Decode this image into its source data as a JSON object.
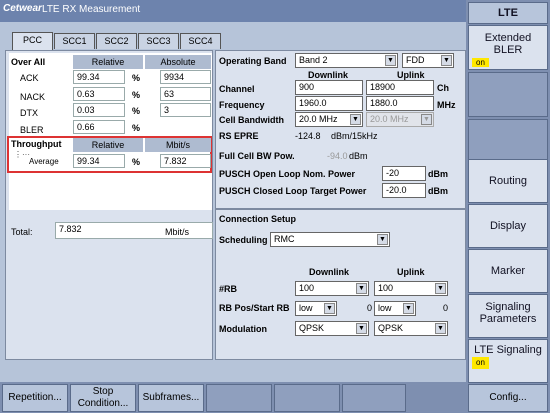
{
  "app": {
    "logo": "Cetwear",
    "title": "LTE RX Measurement"
  },
  "tabs": [
    "PCC",
    "SCC1",
    "SCC2",
    "SCC3",
    "SCC4"
  ],
  "overall": {
    "label": "Over All",
    "col_relative": "Relative",
    "col_absolute": "Absolute",
    "rows": [
      {
        "name": "ACK",
        "rel": "99.34",
        "unit": "%",
        "abs": "9934"
      },
      {
        "name": "NACK",
        "rel": "0.63",
        "unit": "%",
        "abs": "63"
      },
      {
        "name": "DTX",
        "rel": "0.03",
        "unit": "%",
        "abs": "3"
      },
      {
        "name": "BLER",
        "rel": "0.66",
        "unit": "%",
        "abs": ""
      }
    ]
  },
  "throughput": {
    "label": "Throughput",
    "col_relative": "Relative",
    "col_mbit": "Mbit/s",
    "avg_label": "Average",
    "rel": "99.34",
    "unit": "%",
    "mbit": "7.832"
  },
  "total": {
    "label": "Total:",
    "value": "7.832",
    "unit": "Mbit/s"
  },
  "band": {
    "op_band_label": "Operating Band",
    "op_band": "Band 2",
    "duplex": "FDD",
    "downlink": "Downlink",
    "uplink": "Uplink",
    "channel_label": "Channel",
    "ch_dl": "900",
    "ch_ul": "18900",
    "ch_unit": "Ch",
    "freq_label": "Frequency",
    "f_dl": "1960.0",
    "f_ul": "1880.0",
    "f_unit": "MHz",
    "bw_label": "Cell Bandwidth",
    "bw_dl": "20.0 MHz",
    "bw_ul": "20.0 MHz",
    "rsepre_label": "RS EPRE",
    "rsepre": "-124.8",
    "rsepre_unit": "dBm/15kHz",
    "fullcell_label": "Full Cell BW Pow.",
    "fullcell": "-94.0",
    "fullcell_unit": "dBm",
    "pusch_open_label": "PUSCH Open Loop Nom. Power",
    "pusch_open": "-20",
    "pusch_open_unit": "dBm",
    "pusch_closed_label": "PUSCH Closed Loop Target Power",
    "pusch_closed": "-20.0",
    "pusch_closed_unit": "dBm"
  },
  "conn": {
    "title": "Connection Setup",
    "sched_label": "Scheduling",
    "sched": "RMC",
    "downlink": "Downlink",
    "uplink": "Uplink",
    "rb_label": "#RB",
    "rb_dl": "100",
    "rb_ul": "100",
    "rbpos_label": "RB Pos/Start RB",
    "rbpos_dl": "low",
    "rbpos_dl_n": "0",
    "rbpos_ul": "low",
    "rbpos_ul_n": "0",
    "mod_label": "Modulation",
    "mod_dl": "QPSK",
    "mod_ul": "QPSK"
  },
  "sidebar": {
    "header": "LTE",
    "extended": "Extended BLER",
    "on1": "on",
    "routing": "Routing",
    "display": "Display",
    "marker": "Marker",
    "signaling_params": "Signaling Parameters",
    "lte_signaling": "LTE Signaling",
    "on2": "on"
  },
  "bottom": {
    "repetition": "Repetition...",
    "stop": "Stop Condition...",
    "subframes": "Subframes...",
    "config": "Config..."
  }
}
